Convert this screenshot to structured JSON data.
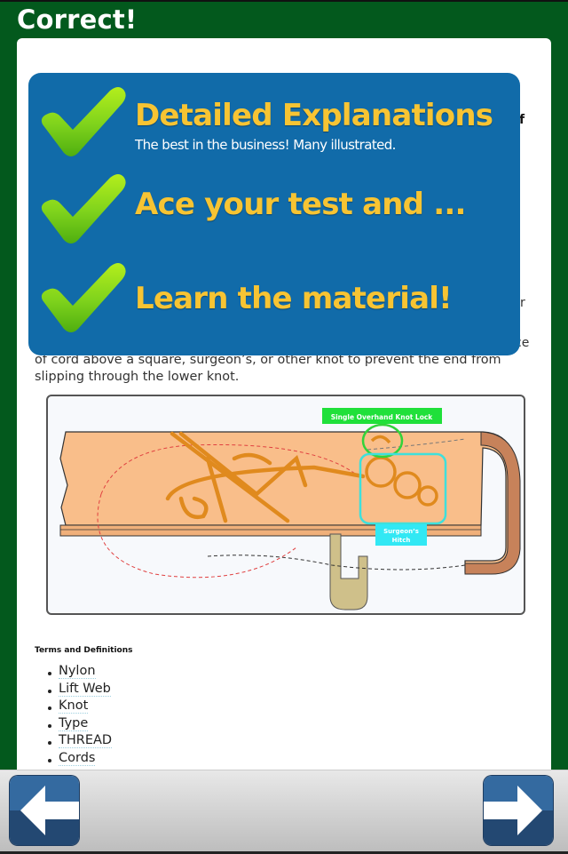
{
  "header": {
    "title": "Correct!"
  },
  "promo": {
    "items": [
      {
        "title": "Detailed Explanations",
        "subtitle": "The best in the business!  Many illustrated."
      },
      {
        "title": "Ace your test and ...",
        "subtitle": ""
      },
      {
        "title": "Learn the material!",
        "subtitle": ""
      }
    ],
    "colors": {
      "background": "#116ba9",
      "title": "#f7c433",
      "check": "#7ed21c"
    }
  },
  "content": {
    "partial_text": {
      "right_edge_1": "f",
      "right_edge_2": "r",
      "right_edge_3": "ce"
    },
    "paragraph": "of cord above a square, surgeon’s, or other knot to prevent the end from slipping through the lower knot.",
    "figure": {
      "labels": {
        "overhand": "Single Overhand Knot Lock",
        "surgeons_line1": "Surgeon’s",
        "surgeons_line2": "Hitch"
      }
    },
    "terms_heading": "Terms and Definitions",
    "terms": [
      "Nylon",
      "Lift Web",
      "Knot",
      "Type",
      "THREAD",
      "Cords"
    ]
  },
  "nav": {
    "prev_icon": "left-arrow-icon",
    "next_icon": "right-arrow-icon"
  },
  "colors": {
    "frame": "#03591d",
    "nav_button_top": "#346aa0",
    "nav_button_bottom": "#234872"
  }
}
